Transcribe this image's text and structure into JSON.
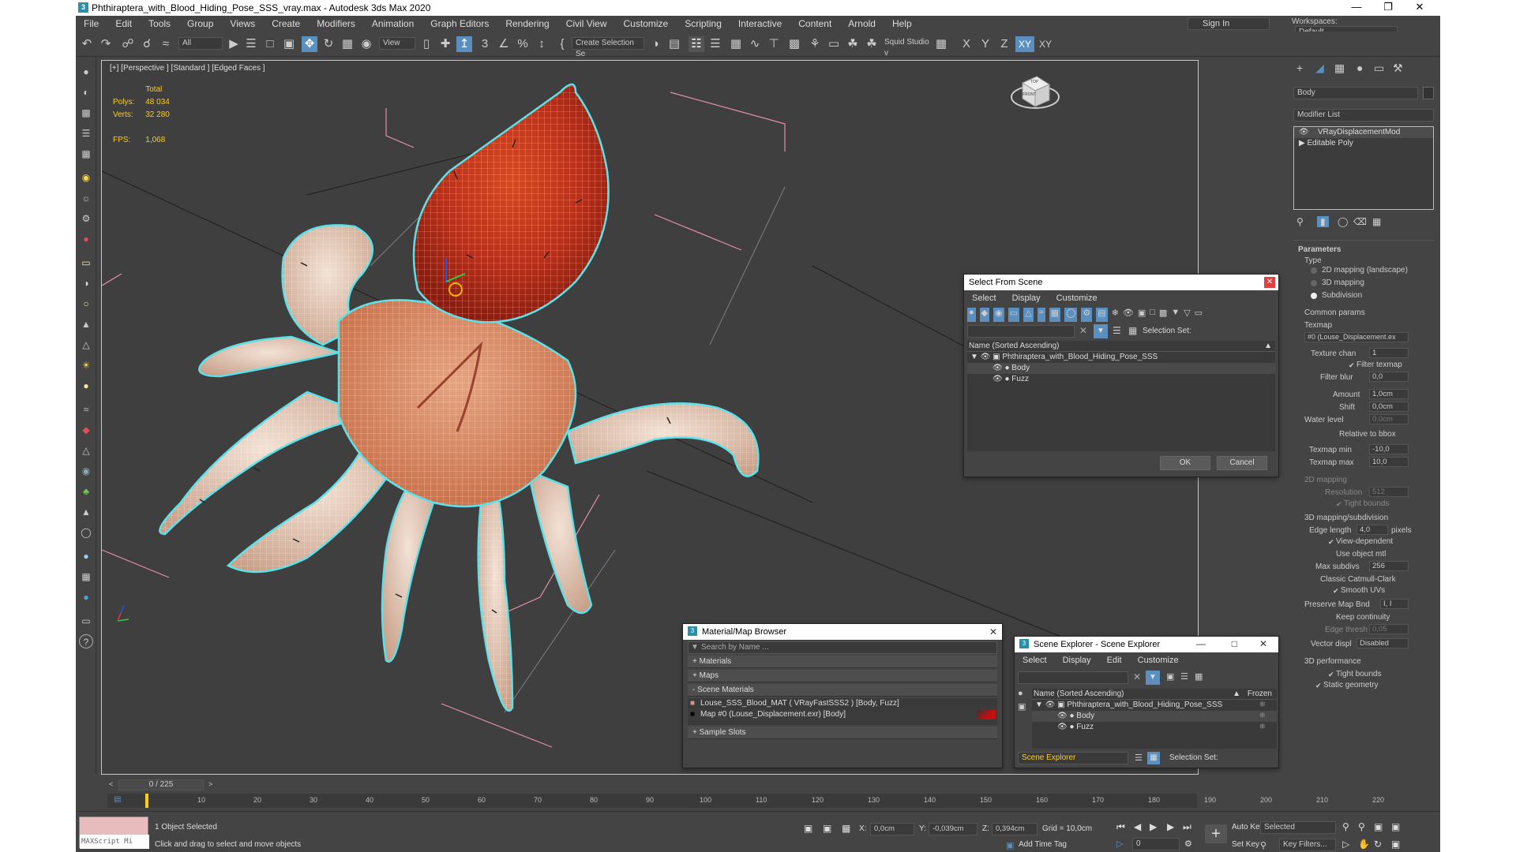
{
  "window": {
    "title": "Phthiraptera_with_Blood_Hiding_Pose_SSS_vray.max - Autodesk 3ds Max 2020",
    "logo": "3"
  },
  "menu": [
    "File",
    "Edit",
    "Tools",
    "Group",
    "Views",
    "Create",
    "Modifiers",
    "Animation",
    "Graph Editors",
    "Rendering",
    "Civil View",
    "Customize",
    "Scripting",
    "Interactive",
    "Content",
    "Arnold",
    "Help"
  ],
  "signin": "Sign In",
  "workspaces": {
    "label": "Workspaces:",
    "value": "Default"
  },
  "toolbar": {
    "filter": "All",
    "refcoord": "View",
    "selset": "Create Selection Se",
    "squid": "Squid Studio v",
    "axes": [
      "X",
      "Y",
      "Z",
      "XY",
      "XY"
    ]
  },
  "viewport": {
    "label": "[+] [Perspective ] [Standard ] [Edged Faces ]",
    "stats": {
      "total": "Total",
      "polys_label": "Polys:",
      "polys": "48 034",
      "verts_label": "Verts:",
      "verts": "32 280",
      "fps_label": "FPS:",
      "fps": "1,068"
    },
    "viewcube": {
      "top": "TOP",
      "front": "FRONT"
    }
  },
  "command_panel": {
    "object_name": "Body",
    "modifier_list": "Modifier List",
    "stack": [
      "VRayDisplacementMod",
      "Editable Poly"
    ],
    "rollout": "Parameters",
    "type_label": "Type",
    "type_options": [
      "2D mapping (landscape)",
      "3D mapping",
      "Subdivision"
    ],
    "type_selected": 2,
    "common": "Common params",
    "texmap_label": "Texmap",
    "texmap": "#0 (Louse_Displacement.ex",
    "texture_chan_label": "Texture chan",
    "texture_chan": "1",
    "filter_texmap": "Filter texmap",
    "filter_blur_label": "Filter blur",
    "filter_blur": "0,0",
    "amount_label": "Amount",
    "amount": "1,0cm",
    "shift_label": "Shift",
    "shift": "0,0cm",
    "water_label": "Water level",
    "water": "0,0cm",
    "relative": "Relative to bbox",
    "tmin_label": "Texmap min",
    "tmin": "-10,0",
    "tmax_label": "Texmap max",
    "tmax": "10,0",
    "map2d": "2D mapping",
    "resolution_label": "Resolution",
    "resolution": "512",
    "tight_bounds_2d": "Tight bounds",
    "map3d": "3D mapping/subdivision",
    "edge_len_label": "Edge length",
    "edge_len": "4,0",
    "pixels": "pixels",
    "view_dep": "View-dependent",
    "use_obj": "Use object mtl",
    "max_subdivs_label": "Max subdivs",
    "max_subdivs": "256",
    "catmull": "Classic Catmull-Clark",
    "smooth_uvs": "Smooth UVs",
    "preserve_label": "Preserve Map Bnd",
    "preserve": "I, I",
    "keep": "Keep continuity",
    "edge_thresh_label": "Edge thresh",
    "edge_thresh": "0,05",
    "vector_label": "Vector displ",
    "vector": "Disabled",
    "perf": "3D performance",
    "tight_bounds": "Tight bounds",
    "static_geom": "Static geometry"
  },
  "select_from_scene": {
    "title": "Select From Scene",
    "menu": [
      "Select",
      "Display",
      "Customize"
    ],
    "selset_label": "Selection Set:",
    "header": "Name (Sorted Ascending)",
    "items": [
      "Phthiraptera_with_Blood_Hiding_Pose_SSS",
      "Body",
      "Fuzz"
    ],
    "ok": "OK",
    "cancel": "Cancel"
  },
  "material_browser": {
    "title": "Material/Map Browser",
    "search": "Search by Name ...",
    "sections": [
      "+ Materials",
      "+ Maps",
      "- Scene Materials",
      "+ Sample Slots"
    ],
    "scene_items": [
      "Louse_SSS_Blood_MAT  ( VRayFastSSS2 )  [Body, Fuzz]",
      "Map #0 (Louse_Displacement.exr)  [Body]"
    ]
  },
  "scene_explorer": {
    "title": "Scene Explorer - Scene Explorer",
    "menu": [
      "Select",
      "Display",
      "Edit",
      "Customize"
    ],
    "header": "Name (Sorted Ascending)",
    "frozen": "Frozen",
    "items": [
      "Phthiraptera_with_Blood_Hiding_Pose_SSS",
      "Body",
      "Fuzz"
    ],
    "footer_name": "Scene Explorer",
    "selset_label": "Selection Set:"
  },
  "timeline": {
    "frame": "0 / 225",
    "ticks": [
      "10",
      "20",
      "30",
      "40",
      "50",
      "60",
      "70",
      "80",
      "90",
      "100",
      "110",
      "120",
      "130",
      "140",
      "150",
      "160",
      "170",
      "180",
      "190",
      "200",
      "210",
      "220"
    ]
  },
  "status": {
    "maxscript": "MAXScript Mi",
    "selected": "1 Object Selected",
    "prompt": "Click and drag to select and move objects",
    "x_label": "X:",
    "x": "0,0cm",
    "y_label": "Y:",
    "y": "-0,039cm",
    "z_label": "Z:",
    "z": "0,394cm",
    "grid": "Grid = 10,0cm",
    "add_time_tag": "Add Time Tag",
    "auto_key": "Auto Key",
    "selected_mode": "Selected",
    "set_key": "Set Key",
    "key_filters": "Key Filters...",
    "frame_field": "0"
  }
}
